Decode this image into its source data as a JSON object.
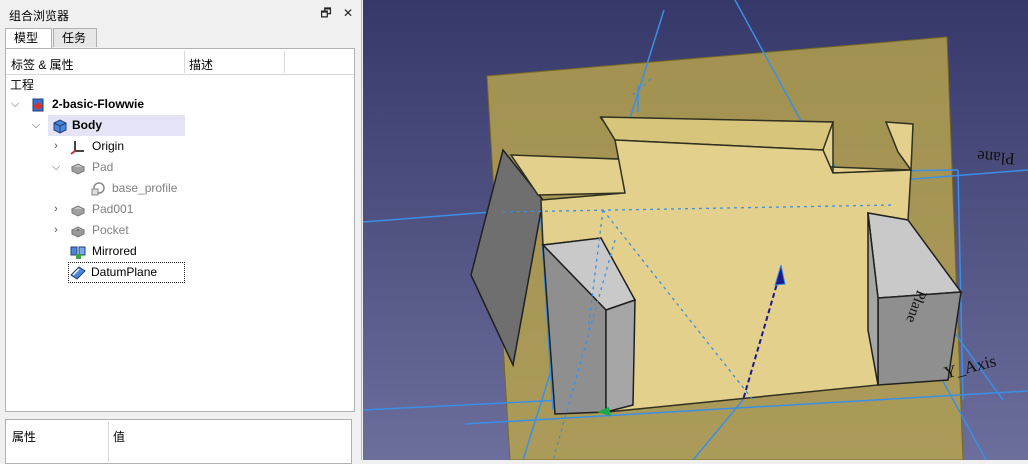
{
  "panel": {
    "title": "组合浏览器",
    "float_glyph": "🗗",
    "close_glyph": "✕",
    "tabs": [
      "模型",
      "任务"
    ],
    "columns": {
      "label": "标签 & 属性",
      "description": "描述"
    },
    "root_label": "工程",
    "tree": [
      {
        "label": "2-basic-Flowwie",
        "icon": "document-icon",
        "expanded": true
      },
      {
        "label": "Body",
        "icon": "body-icon",
        "expanded": true,
        "selected": true
      },
      {
        "label": "Origin",
        "icon": "origin-icon",
        "expanded": false
      },
      {
        "label": "Pad",
        "icon": "pad-icon",
        "expanded": true,
        "hidden": true
      },
      {
        "label": "base_profile",
        "icon": "sketch-icon",
        "hidden": true
      },
      {
        "label": "Pad001",
        "icon": "pad-icon",
        "expanded": false,
        "hidden": true
      },
      {
        "label": "Pocket",
        "icon": "pocket-icon",
        "expanded": false,
        "hidden": true
      },
      {
        "label": "Mirrored",
        "icon": "mirrored-icon"
      },
      {
        "label": "DatumPlane",
        "icon": "datum-plane-icon",
        "focused": true
      }
    ],
    "property_columns": {
      "property": "属性",
      "value": "值"
    }
  },
  "viewport": {
    "labels": {
      "plane_top": "Plane",
      "plane_side": "Plane",
      "axis": "Y_Axis"
    },
    "colors": {
      "background_top": "#353869",
      "background_bottom": "#6c6e9c",
      "datum_plane": "#b9a54b",
      "part_face": "#e3d08c",
      "part_side": "#8f8f8f",
      "axis_lines": "#3a8fe6"
    }
  }
}
